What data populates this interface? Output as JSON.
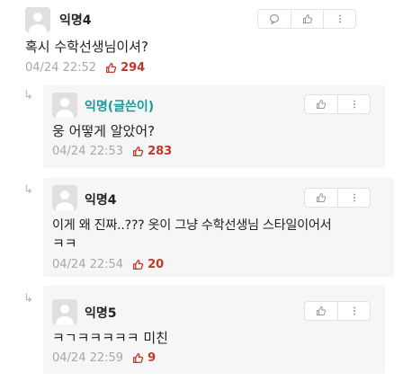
{
  "comments": [
    {
      "nick": "익명4",
      "text": "혹시 수학선생님이셔?",
      "time": "04/24 22:52",
      "votes": "294"
    },
    {
      "nick": "익명(글쓴이)",
      "text": "웅 어떻게 알았어?",
      "time": "04/24 22:53",
      "votes": "283"
    },
    {
      "nick": "익명4",
      "text": "이게 왜 진짜..??? 옷이 그냥 수학선생님 스타일이어서",
      "text2": "ㅋㅋ",
      "time": "04/24 22:54",
      "votes": "20"
    },
    {
      "nick": "익명5",
      "text": "ㅋㄱㅋㅋㅋㅋㅋ 미친",
      "time": "04/24 22:59",
      "votes": "9"
    }
  ],
  "icons": {
    "reply": "reply-arrow-icon",
    "comment": "comment-bubble-icon",
    "like": "thumbs-up-icon",
    "more": "more-vertical-icon"
  },
  "colors": {
    "writer_nick": "#1a9b9b",
    "vote": "#c0392b",
    "meta": "#a8a8a8",
    "reply_bg": "#f6f6f6"
  }
}
